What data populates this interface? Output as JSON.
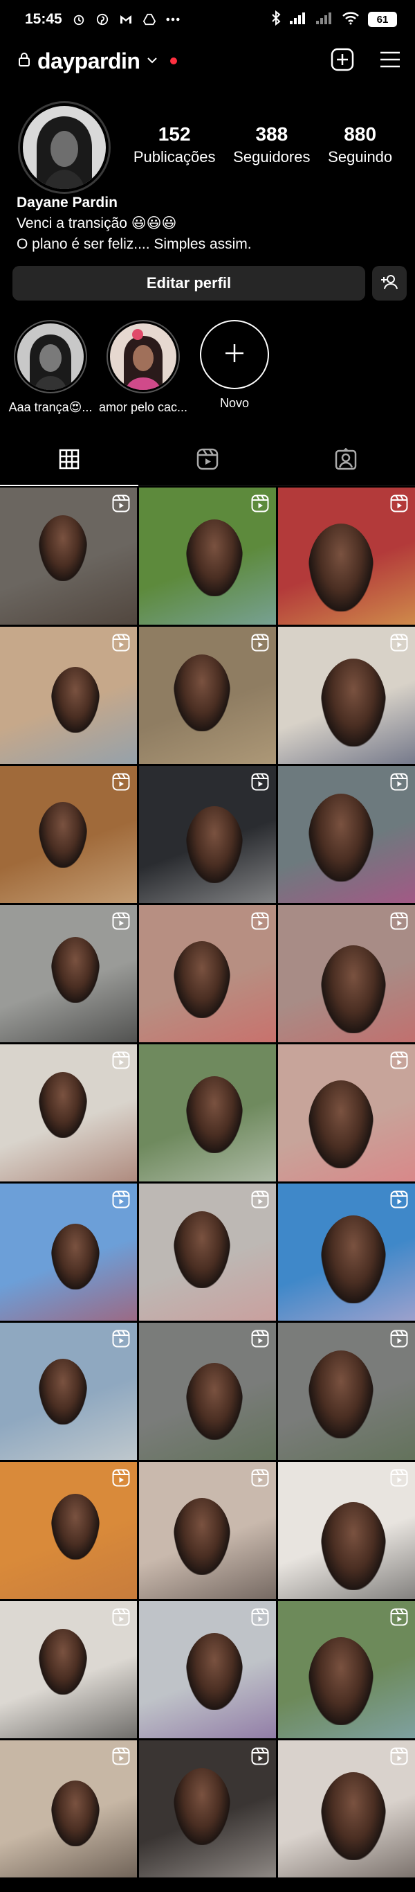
{
  "status_bar": {
    "time": "15:45",
    "battery": "61"
  },
  "header": {
    "username": "daypardin"
  },
  "profile": {
    "stats": [
      {
        "value": "152",
        "label": "Publicações"
      },
      {
        "value": "388",
        "label": "Seguidores"
      },
      {
        "value": "880",
        "label": "Seguindo"
      }
    ],
    "name": "Dayane Pardin",
    "bio_line1": "Venci a transição 😃😃😃",
    "bio_line2": "O plano é ser feliz.... Simples assim.",
    "edit_button": "Editar perfil"
  },
  "highlights": [
    {
      "label": "Aaa trança😍..."
    },
    {
      "label": "amor pelo cac..."
    },
    {
      "label": "Novo"
    }
  ],
  "tabs": [
    {
      "icon": "grid-icon",
      "active": true
    },
    {
      "icon": "reels-icon",
      "active": false
    },
    {
      "icon": "tagged-icon",
      "active": false
    }
  ],
  "colors": {
    "background": "#000000",
    "button": "#262626",
    "live_dot": "#ff3040"
  },
  "grid": [
    {
      "bg": "#6b6660",
      "accent": "#3a2a20",
      "reel": true
    },
    {
      "bg": "#5d8a3c",
      "accent": "#8fb5df",
      "reel": true
    },
    {
      "bg": "#b33a3a",
      "accent": "#e8d25a",
      "reel": true
    },
    {
      "bg": "#c6a88a",
      "accent": "#6a9bc7",
      "reel": true
    },
    {
      "bg": "#8f7d62",
      "accent": "#c7b08a",
      "reel": true
    },
    {
      "bg": "#d8d2c8",
      "accent": "#1e2b55",
      "reel": true
    },
    {
      "bg": "#a06a3a",
      "accent": "#e2c9a5",
      "reel": true
    },
    {
      "bg": "#2a2c30",
      "accent": "#cfcfcf",
      "reel": true
    },
    {
      "bg": "#6d7a7e",
      "accent": "#d23c8c",
      "reel": true
    },
    {
      "bg": "#9a9b98",
      "accent": "#111111",
      "reel": true
    },
    {
      "bg": "#b78f82",
      "accent": "#d8575a",
      "reel": true
    },
    {
      "bg": "#a88c86",
      "accent": "#d8575a",
      "reel": true
    },
    {
      "bg": "#d9d4cc",
      "accent": "#8a4a3a",
      "reel": true
    },
    {
      "bg": "#6f8a5e",
      "accent": "#e6e6e6",
      "reel": false
    },
    {
      "bg": "#c7a49a",
      "accent": "#e86f7a",
      "reel": true
    },
    {
      "bg": "#6c9fd8",
      "accent": "#c63a3a",
      "reel": true
    },
    {
      "bg": "#bdb8b4",
      "accent": "#d48a8a",
      "reel": true
    },
    {
      "bg": "#3f88c9",
      "accent": "#f0b8d0",
      "reel": true
    },
    {
      "bg": "#8fa8c0",
      "accent": "#e9e4d8",
      "reel": true
    },
    {
      "bg": "#7a7c7a",
      "accent": "#4f6a40",
      "reel": true
    },
    {
      "bg": "#7a7c7a",
      "accent": "#4f6a40",
      "reel": true
    },
    {
      "bg": "#d98a3a",
      "accent": "#b8703f",
      "reel": true
    },
    {
      "bg": "#c9b9ad",
      "accent": "#2b2220",
      "reel": true
    },
    {
      "bg": "#e8e4df",
      "accent": "#2a2a2a",
      "reel": true
    },
    {
      "bg": "#dcd8d2",
      "accent": "#111111",
      "reel": true
    },
    {
      "bg": "#bfc3c8",
      "accent": "#6a3f8a",
      "reel": true
    },
    {
      "bg": "#6d8a5a",
      "accent": "#8fb5df",
      "reel": true
    },
    {
      "bg": "#c7b7a5",
      "accent": "#241a15",
      "reel": true
    },
    {
      "bg": "#3a3533",
      "accent": "#d8d2cc",
      "reel": true
    },
    {
      "bg": "#d9d2cc",
      "accent": "#2a1f1a",
      "reel": true
    }
  ]
}
